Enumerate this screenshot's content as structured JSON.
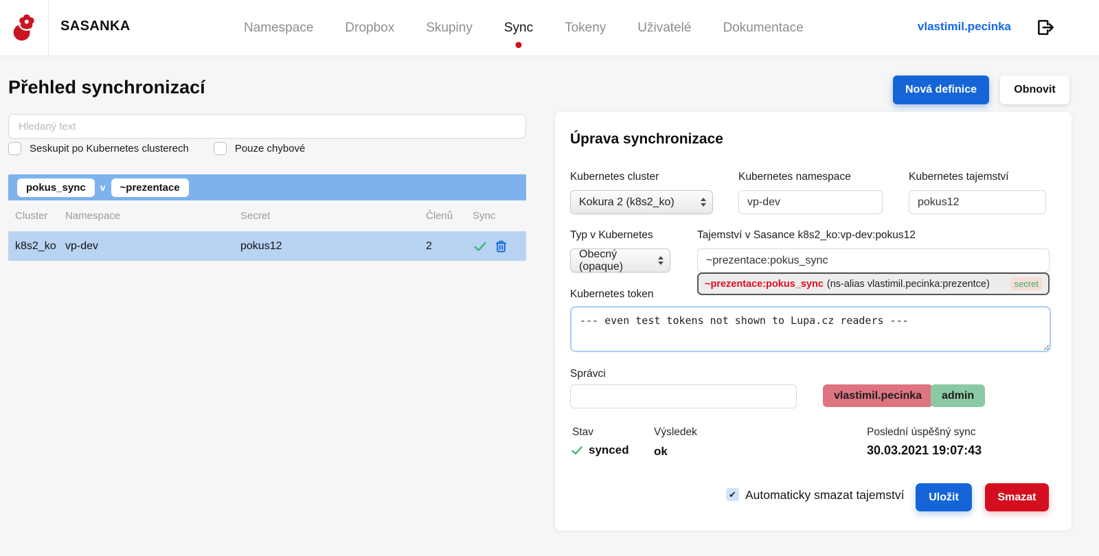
{
  "nav": {
    "brand": "SASANKA",
    "items": [
      {
        "label": "Namespace",
        "active": false
      },
      {
        "label": "Dropbox",
        "active": false
      },
      {
        "label": "Skupiny",
        "active": false
      },
      {
        "label": "Sync",
        "active": true
      },
      {
        "label": "Tokeny",
        "active": false
      },
      {
        "label": "Uživatelé",
        "active": false
      },
      {
        "label": "Dokumentace",
        "active": false
      }
    ],
    "user": "vlastimil.pecinka"
  },
  "page": {
    "title": "Přehled synchronizací",
    "new_definition_label": "Nová definice",
    "refresh_label": "Obnovit"
  },
  "filters": {
    "search_placeholder": "Hledaný text",
    "group_checkbox_label": "Seskupit po Kubernetes clusterech",
    "errors_checkbox_label": "Pouze chybové"
  },
  "sync_table": {
    "group_badges": [
      "pokus_sync",
      "~prezentace"
    ],
    "group_separator": "v",
    "columns": [
      "Cluster",
      "Namespace",
      "Secret",
      "Členů",
      "Sync"
    ],
    "rows": [
      {
        "cluster": "k8s2_ko",
        "namespace": "vp-dev",
        "secret": "pokus12",
        "members": "2",
        "synced": true
      }
    ]
  },
  "edit_panel": {
    "title": "Úprava synchronizace",
    "cluster_label": "Kubernetes cluster",
    "cluster_value": "Kokura 2 (k8s2_ko)",
    "namespace_label": "Kubernetes namespace",
    "namespace_value": "vp-dev",
    "secret_label": "Kubernetes tajemství",
    "secret_value": "pokus12",
    "type_label": "Typ v Kubernetes",
    "type_value": "Obecný (opaque)",
    "sasanka_secret_label": "Tajemství v Sasance k8s2_ko:vp-dev:pokus12",
    "sasanka_secret_value": "~prezentace:pokus_sync",
    "suggestion": {
      "name": "~prezentace:pokus_sync",
      "detail": "(ns-alias vlastimil.pecinka:prezentce)",
      "badge": "secret"
    },
    "token_label": "Kubernetes token",
    "token_value": "--- even test tokens not shown to Lupa.cz readers ---",
    "admins_label": "Správci",
    "admins_input_value": "",
    "admin_badges": [
      {
        "label": "vlastimil.pecinka"
      },
      {
        "label": "admin"
      }
    ],
    "status_label": "Stav",
    "status_value": "synced",
    "result_label": "Výsledek",
    "result_value": "ok",
    "last_sync_label": "Poslední úspěšný sync",
    "last_sync_value": "30.03.2021 19:07:43",
    "auto_delete_label": "Automaticky smazat tajemství",
    "save_label": "Uložit",
    "delete_label": "Smazat"
  },
  "colors": {
    "accent_blue": "#1565d8",
    "link_blue": "#1268e8",
    "danger_red": "#d30f1f",
    "logo_red": "#c91422",
    "active_dot_red": "#d40f1e",
    "table_group_blue": "#7db2ee",
    "table_row_blue": "#b9d3f3",
    "success_green": "#35b66e",
    "trash_blue": "#1565d8",
    "admin_badge_red": "#dd7480",
    "admin_badge_green": "#8bc9a4",
    "secret_badge_bg": "#f8ddd2",
    "secret_badge_text": "#2fae74",
    "suggestion_name_red": "#e0101e"
  }
}
